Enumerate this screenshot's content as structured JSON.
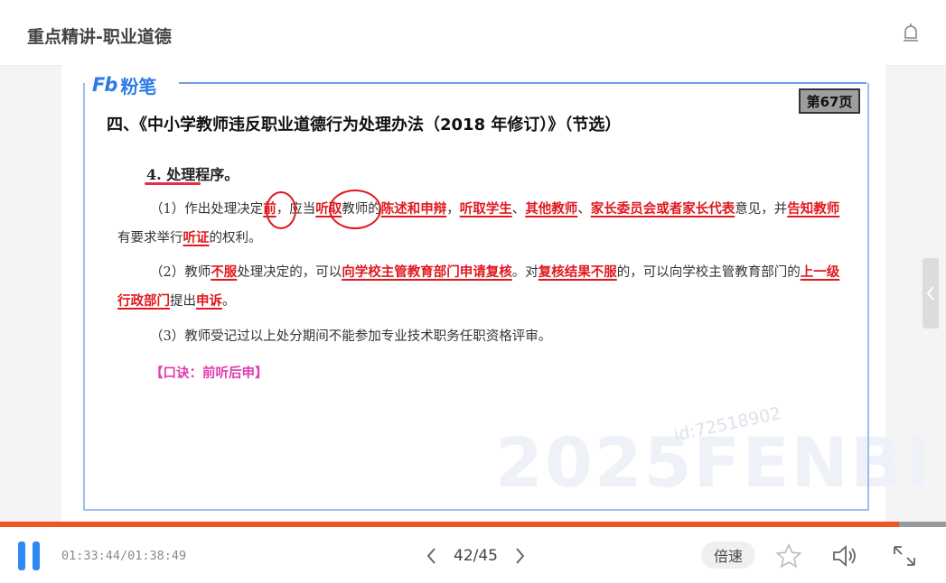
{
  "header": {
    "title": "重点精讲-职业道德"
  },
  "icons": {
    "header_right": "alarm-bell-icon",
    "play": "pause-icon",
    "prev": "chevron-left-icon",
    "next": "chevron-right-icon",
    "star": "star-icon",
    "volume": "volume-icon",
    "fullscreen": "fullscreen-icon",
    "side": "chevron-left-icon"
  },
  "slide": {
    "brand": "粉笔",
    "brand_mark": "Fb",
    "page_badge": "第67页",
    "title": "四、《中小学教师违反职业道德行为处理办法（2018 年修订）》（节选）",
    "subhead": "4. 处理程序。",
    "p1": {
      "t1": "（1）作出处理决定",
      "h1": "前",
      "t2": "，应当",
      "h2": "听取",
      "t3": "教师的",
      "h3": "陈述和申辩",
      "t4": "，",
      "h4": "听取学生",
      "t5": "、",
      "h5": "其他教师",
      "t6": "、",
      "h6": "家长委员会或者家长代表",
      "t7": "意见，并",
      "h7": "告知教师",
      "t8": "有要求举行",
      "h8": "听证",
      "t9": "的权利。"
    },
    "p2": {
      "t1": "（2）教师",
      "h1": "不服",
      "t2": "处理决定的，可以",
      "h2": "向学校主管教育部门申请复核",
      "t3": "。对",
      "h3": "复核结果不服",
      "t4": "的，可以向学校主管教育部门的",
      "h4": "上一级行政部门",
      "t5": "提出",
      "h5": "申诉",
      "t6": "。"
    },
    "p3": "（3）教师受记过以上处分期间不能参加专业技术职务任职资格评审。",
    "mnemonic": "【口诀：前听后申】",
    "watermark": "2025FENBI",
    "watermark_id": "id:72518902"
  },
  "player": {
    "progress": 0.95,
    "time": "01:33:44/01:38:49",
    "page": "42/45",
    "speed_label": "倍速"
  },
  "colors": {
    "accent": "#2f89f5",
    "progress": "#f05424",
    "highlight": "#e0191f",
    "mnemonic": "#e33ab0",
    "frame": "#9ebfee"
  }
}
